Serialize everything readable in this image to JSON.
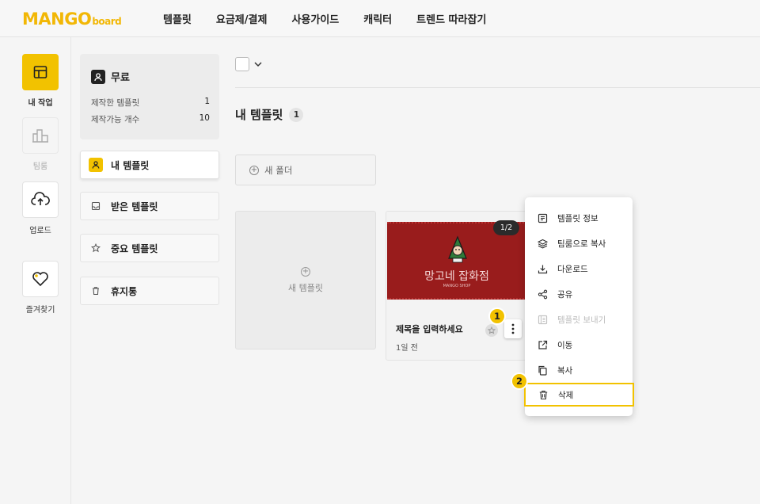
{
  "logo": {
    "main": "MANGO",
    "sub": "board"
  },
  "nav": [
    "템플릿",
    "요금제/결제",
    "사용가이드",
    "캐릭터",
    "트렌드 따라잡기"
  ],
  "rail": [
    {
      "label": "내 작업",
      "icon": "layout-icon",
      "active": true
    },
    {
      "label": "팀룸",
      "icon": "buildings-icon",
      "active": false
    },
    {
      "label": "업로드",
      "icon": "cloud-upload-icon",
      "active": false
    },
    {
      "label": "즐겨찾기",
      "icon": "heart-icon",
      "active": false
    }
  ],
  "plan": {
    "name": "무료",
    "rows": [
      {
        "label": "제작한 템플릿",
        "value": "1"
      },
      {
        "label": "제작가능 개수",
        "value": "10"
      }
    ]
  },
  "side_menu": [
    {
      "label": "내 템플릿",
      "icon": "person-icon"
    },
    {
      "label": "받은 템플릿",
      "icon": "inbox-icon"
    },
    {
      "label": "중요 템플릿",
      "icon": "star-icon"
    },
    {
      "label": "휴지통",
      "icon": "trash-icon"
    }
  ],
  "main": {
    "section_title": "내 템플릿",
    "count": "1",
    "new_folder": "새 폴더",
    "new_template": "새 템플릿"
  },
  "card": {
    "page": "1/2",
    "thumb_title": "망고네 잡화점",
    "thumb_sub": "MANGO SHOP",
    "title": "제목을 입력하세요",
    "time": "1일 전"
  },
  "context_menu": [
    {
      "label": "템플릿 정보",
      "icon": "info-doc-icon",
      "disabled": false
    },
    {
      "label": "팀룸으로 복사",
      "icon": "layers-icon",
      "disabled": false
    },
    {
      "label": "다운로드",
      "icon": "download-icon",
      "disabled": false
    },
    {
      "label": "공유",
      "icon": "share-icon",
      "disabled": false
    },
    {
      "label": "템플릿 보내기",
      "icon": "send-doc-icon",
      "disabled": true
    },
    {
      "label": "이동",
      "icon": "external-link-icon",
      "disabled": false
    },
    {
      "label": "복사",
      "icon": "copy-icon",
      "disabled": false
    },
    {
      "label": "삭제",
      "icon": "trash-icon",
      "disabled": false
    }
  ],
  "steps": [
    "1",
    "2"
  ],
  "colors": {
    "accent": "#f2c200",
    "thumb_bg": "#991c1c"
  }
}
